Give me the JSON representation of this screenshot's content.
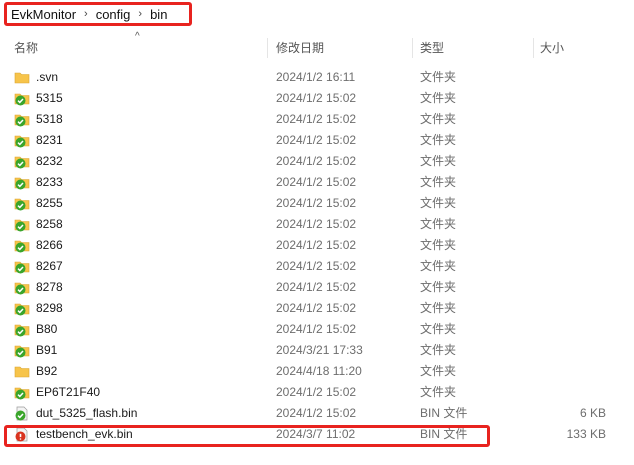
{
  "breadcrumb": [
    "EvkMonitor",
    "config",
    "bin"
  ],
  "columns": {
    "name": "名称",
    "date": "修改日期",
    "type": "类型",
    "size": "大小"
  },
  "sort_indicator": "^",
  "colors": {
    "highlight": "#e8231f",
    "folder": "#f7c44a",
    "sync_ok": "#3aa52b",
    "sync_error": "#d9331f"
  },
  "files": [
    {
      "name": ".svn",
      "date": "2024/1/2 16:11",
      "type": "文件夹",
      "size": "",
      "icon": "folder-icon"
    },
    {
      "name": "5315",
      "date": "2024/1/2 15:02",
      "type": "文件夹",
      "size": "",
      "icon": "folder-synced-icon"
    },
    {
      "name": "5318",
      "date": "2024/1/2 15:02",
      "type": "文件夹",
      "size": "",
      "icon": "folder-synced-icon"
    },
    {
      "name": "8231",
      "date": "2024/1/2 15:02",
      "type": "文件夹",
      "size": "",
      "icon": "folder-synced-icon"
    },
    {
      "name": "8232",
      "date": "2024/1/2 15:02",
      "type": "文件夹",
      "size": "",
      "icon": "folder-synced-icon"
    },
    {
      "name": "8233",
      "date": "2024/1/2 15:02",
      "type": "文件夹",
      "size": "",
      "icon": "folder-synced-icon"
    },
    {
      "name": "8255",
      "date": "2024/1/2 15:02",
      "type": "文件夹",
      "size": "",
      "icon": "folder-synced-icon"
    },
    {
      "name": "8258",
      "date": "2024/1/2 15:02",
      "type": "文件夹",
      "size": "",
      "icon": "folder-synced-icon"
    },
    {
      "name": "8266",
      "date": "2024/1/2 15:02",
      "type": "文件夹",
      "size": "",
      "icon": "folder-synced-icon"
    },
    {
      "name": "8267",
      "date": "2024/1/2 15:02",
      "type": "文件夹",
      "size": "",
      "icon": "folder-synced-icon"
    },
    {
      "name": "8278",
      "date": "2024/1/2 15:02",
      "type": "文件夹",
      "size": "",
      "icon": "folder-synced-icon"
    },
    {
      "name": "8298",
      "date": "2024/1/2 15:02",
      "type": "文件夹",
      "size": "",
      "icon": "folder-synced-icon"
    },
    {
      "name": "B80",
      "date": "2024/1/2 15:02",
      "type": "文件夹",
      "size": "",
      "icon": "folder-synced-icon"
    },
    {
      "name": "B91",
      "date": "2024/3/21 17:33",
      "type": "文件夹",
      "size": "",
      "icon": "folder-synced-icon"
    },
    {
      "name": "B92",
      "date": "2024/4/18 11:20",
      "type": "文件夹",
      "size": "",
      "icon": "folder-icon"
    },
    {
      "name": "EP6T21F40",
      "date": "2024/1/2 15:02",
      "type": "文件夹",
      "size": "",
      "icon": "folder-synced-icon"
    },
    {
      "name": "dut_5325_flash.bin",
      "date": "2024/1/2 15:02",
      "type": "BIN 文件",
      "size": "6 KB",
      "icon": "file-synced-icon"
    },
    {
      "name": "testbench_evk.bin",
      "date": "2024/3/7 11:02",
      "type": "BIN 文件",
      "size": "133 KB",
      "icon": "file-modified-icon"
    }
  ]
}
